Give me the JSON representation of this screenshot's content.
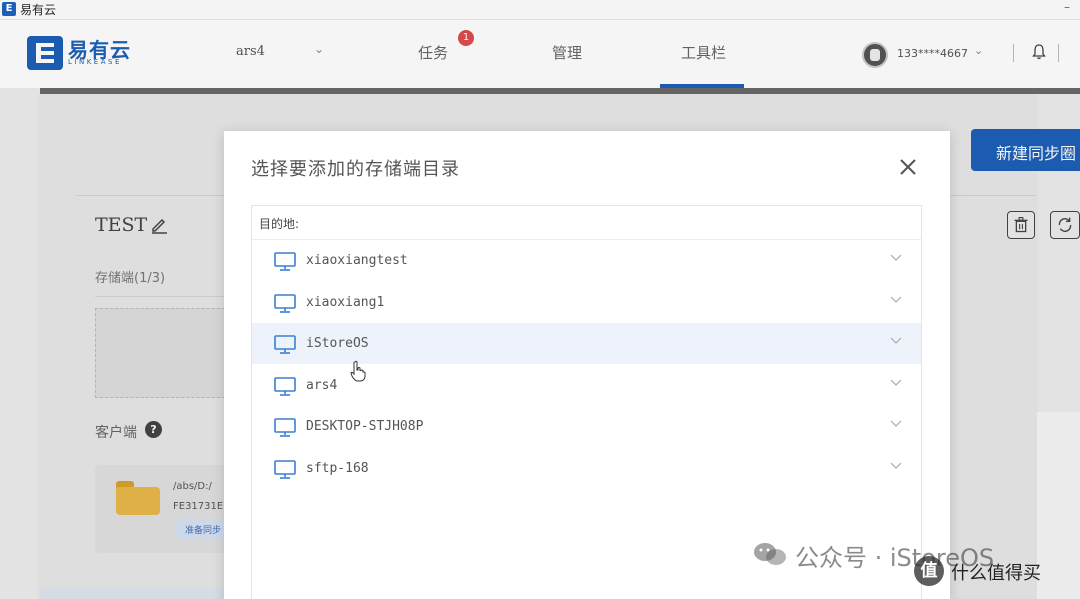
{
  "window": {
    "title": "易有云",
    "app_icon_glyph": "E",
    "minimize_glyph": "–"
  },
  "nav": {
    "logo_name": "易有云",
    "logo_sub": "LINKEASE",
    "server": "ars4",
    "items": [
      {
        "label": "任务",
        "badge": "1"
      },
      {
        "label": "管理"
      },
      {
        "label": "工具栏",
        "active": true
      }
    ],
    "user_phone": "133****4667",
    "chevron_glyph": "⌄"
  },
  "background": {
    "new_circle_button": "新建同步圈",
    "circle_name": "TEST",
    "storage_label": "存储端(1/3)",
    "client_label": "客户端",
    "help_glyph": "?",
    "client_path": "/abs/D:/",
    "client_id": "FE31731E",
    "client_tag": "准备同步"
  },
  "modal": {
    "title": "选择要添加的存储端目录",
    "destination_label": "目的地:",
    "devices": [
      {
        "name": "xiaoxiangtest"
      },
      {
        "name": "xiaoxiang1"
      },
      {
        "name": "iStoreOS",
        "selected": true
      },
      {
        "name": "ars4"
      },
      {
        "name": "DESKTOP-STJH08P"
      },
      {
        "name": "sftp-168"
      }
    ]
  },
  "watermark": {
    "text": "公众号 · iStoreOS",
    "site_logo_glyph": "值",
    "site_name": "什么值得买"
  },
  "colors": {
    "brand_blue": "#1d5fb8",
    "badge_red": "#e04a4a",
    "row_selected": "#eef3fb",
    "folder_yellow": "#e8b84a"
  }
}
